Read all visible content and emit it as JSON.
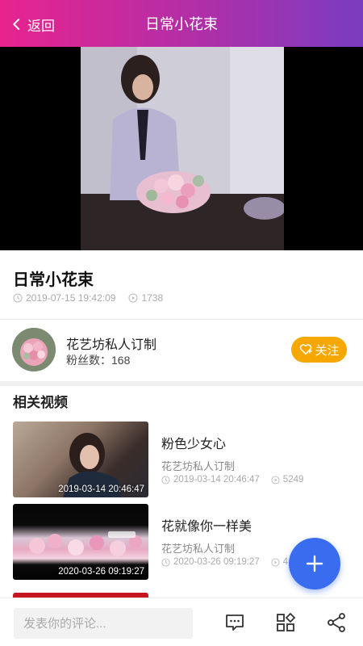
{
  "header": {
    "back_label": "返回",
    "title": "日常小花束"
  },
  "video": {
    "title": "日常小花束",
    "date": "2019-07-15 19:42:09",
    "views": "1738"
  },
  "author": {
    "name": "花艺坊私人订制",
    "fans": "粉丝数：168",
    "follow_label": "关注"
  },
  "related": {
    "heading": "相关视频",
    "items": [
      {
        "title": "粉色少女心",
        "author": "花艺坊私人订制",
        "date": "2019-03-14 20:46:47",
        "views": "5249",
        "thumb_date": "2019-03-14 20:46:47"
      },
      {
        "title": "花就像你一样美",
        "author": "花艺坊私人订制",
        "date": "2020-03-26 09:19:27",
        "views": "4",
        "thumb_date": "2020-03-26 09:19:27"
      }
    ]
  },
  "comment": {
    "placeholder": "发表你的评论..."
  },
  "colors": {
    "header_start": "#e8238e",
    "header_end": "#7a3cc0",
    "follow": "#f7a800",
    "fab": "#3a6cf0"
  },
  "icons": {
    "back": "chevron-left-icon",
    "clock": "clock-icon",
    "play": "play-circle-icon",
    "follow": "heart-plus-icon",
    "fab": "plus-icon",
    "comment": "comment-icon",
    "apps": "apps-icon",
    "share": "share-icon"
  }
}
